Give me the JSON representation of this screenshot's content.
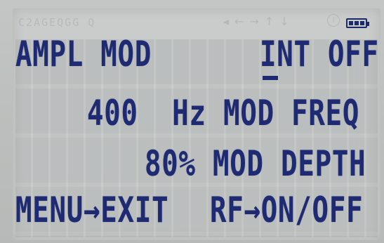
{
  "status_bar": {
    "ghost_text": "C2AGEQGG Q",
    "ghost_arrows": [
      "◂",
      "←",
      "→",
      "↑",
      "↓"
    ],
    "ghost_info": "i",
    "battery_level": 1.0,
    "battery_color": "#1b2a6b"
  },
  "display": {
    "text_color": "#1e2a72",
    "background_color": "#c9ccca",
    "row1": {
      "left": "AMPL MOD",
      "right": "INT OFF"
    },
    "row2": "400  Hz MOD FREQ",
    "row3": "80% MOD DEPTH",
    "row4": {
      "left": "MENU→EXIT",
      "right": "RF→ON/OFF"
    }
  }
}
